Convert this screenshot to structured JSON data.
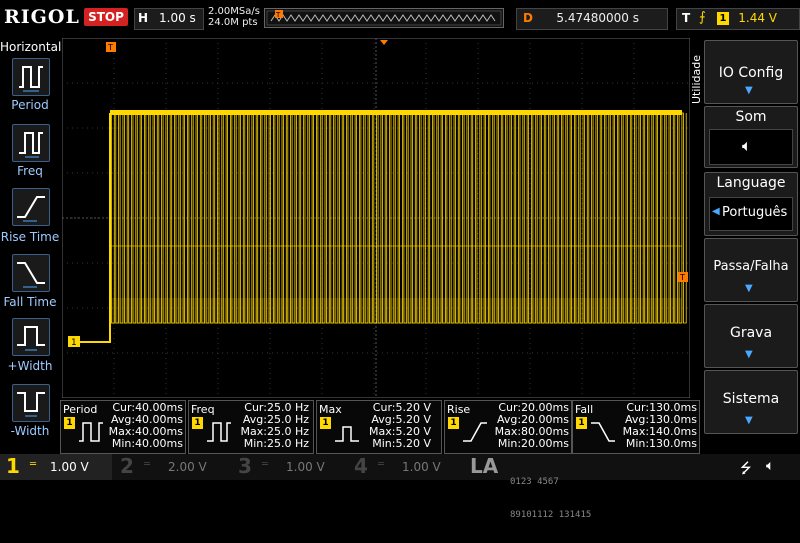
{
  "brand": "RIGOL",
  "run_status": "STOP",
  "timebase": {
    "label": "H",
    "value": "1.00 s"
  },
  "sample": {
    "rate": "2.00MSa/s",
    "points": "24.0M pts"
  },
  "delay": {
    "label": "D",
    "value": "5.47480000 s"
  },
  "trigger": {
    "label": "T",
    "source": "1",
    "level": "1.44 V"
  },
  "horizontal_menu": {
    "title": "Horizontal",
    "items": [
      {
        "label": "Period",
        "icon": "period-icon"
      },
      {
        "label": "Freq",
        "icon": "frequency-icon"
      },
      {
        "label": "Rise Time",
        "icon": "rise-time-icon"
      },
      {
        "label": "Fall Time",
        "icon": "fall-time-icon"
      },
      {
        "label": "+Width",
        "icon": "positive-width-icon"
      },
      {
        "label": "-Width",
        "icon": "negative-width-icon"
      }
    ]
  },
  "utility_menu": {
    "title": "Utilidade",
    "items": [
      {
        "label": "IO Config"
      },
      {
        "label": "Som",
        "icon": "speaker-muted-icon"
      },
      {
        "label": "Language",
        "value": "Português"
      },
      {
        "label": "Passa/Falha"
      },
      {
        "label": "Grava"
      },
      {
        "label": "Sistema"
      }
    ]
  },
  "channel_marker": "1",
  "measurements": [
    {
      "name": "Period",
      "cur": "Cur:40.00ms",
      "avg": "Avg:40.00ms",
      "max": "Max:40.00ms",
      "min": "Min:40.00ms"
    },
    {
      "name": "Freq",
      "cur": "Cur:25.0 Hz",
      "avg": "Avg:25.0 Hz",
      "max": "Max:25.0 Hz",
      "min": "Min:25.0 Hz"
    },
    {
      "name": "Max",
      "cur": "Cur:5.20 V",
      "avg": "Avg:5.20 V",
      "max": "Max:5.20 V",
      "min": "Min:5.20 V"
    },
    {
      "name": "Rise",
      "cur": "Cur:20.00ms",
      "avg": "Avg:20.00ms",
      "max": "Max:80.00ms",
      "min": "Min:20.00ms"
    },
    {
      "name": "Fall",
      "cur": "Cur:130.0ms",
      "avg": "Avg:130.0ms",
      "max": "Max:140.0ms",
      "min": "Min:130.0ms"
    }
  ],
  "channels": [
    {
      "num": "1",
      "scale": "1.00 V",
      "color": "#ffd800",
      "active": true
    },
    {
      "num": "2",
      "scale": "2.00 V",
      "color": "#00c8e0",
      "active": false
    },
    {
      "num": "3",
      "scale": "1.00 V",
      "color": "#e040e0",
      "active": false
    },
    {
      "num": "4",
      "scale": "1.00 V",
      "color": "#3060ff",
      "active": false
    }
  ],
  "la": {
    "label": "LA",
    "row1": "0123 4567",
    "row2": "89101112 131415"
  },
  "colors": {
    "ch1": "#ffd800",
    "accent": "#4aa8ff",
    "stop": "#d42222",
    "trigger": "#ff7a00"
  }
}
